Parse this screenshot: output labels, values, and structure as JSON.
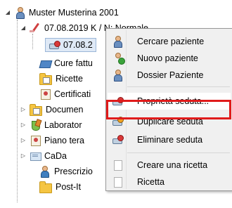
{
  "tree": {
    "root": "Muster Musterina 2001",
    "session_date": "07.08.2019 K / N: Normale",
    "session_child": "07.08.2",
    "items": [
      "Cure fattu",
      "Ricette",
      "Certificati",
      "Documen",
      "Laborator",
      "Piano tera",
      "CaDa",
      "Prescrizio",
      "Post-It"
    ]
  },
  "context_menu": {
    "items": [
      {
        "label": "Cercare paziente",
        "icon": "patient-search-icon"
      },
      {
        "label": "Nuovo paziente",
        "icon": "patient-add-icon"
      },
      {
        "label": "Dossier Paziente",
        "icon": "patient-dossier-icon"
      },
      {
        "label": "Proprietà seduta...",
        "icon": "session-properties-icon"
      },
      {
        "label": "Duplicare seduta",
        "icon": "session-duplicate-icon"
      },
      {
        "label": "Eliminare seduta",
        "icon": "session-delete-icon"
      },
      {
        "label": "Creare una ricetta",
        "icon": "document-icon"
      },
      {
        "label": "Ricetta",
        "icon": "document-icon"
      }
    ],
    "highlight_color": "#e01b1b"
  }
}
